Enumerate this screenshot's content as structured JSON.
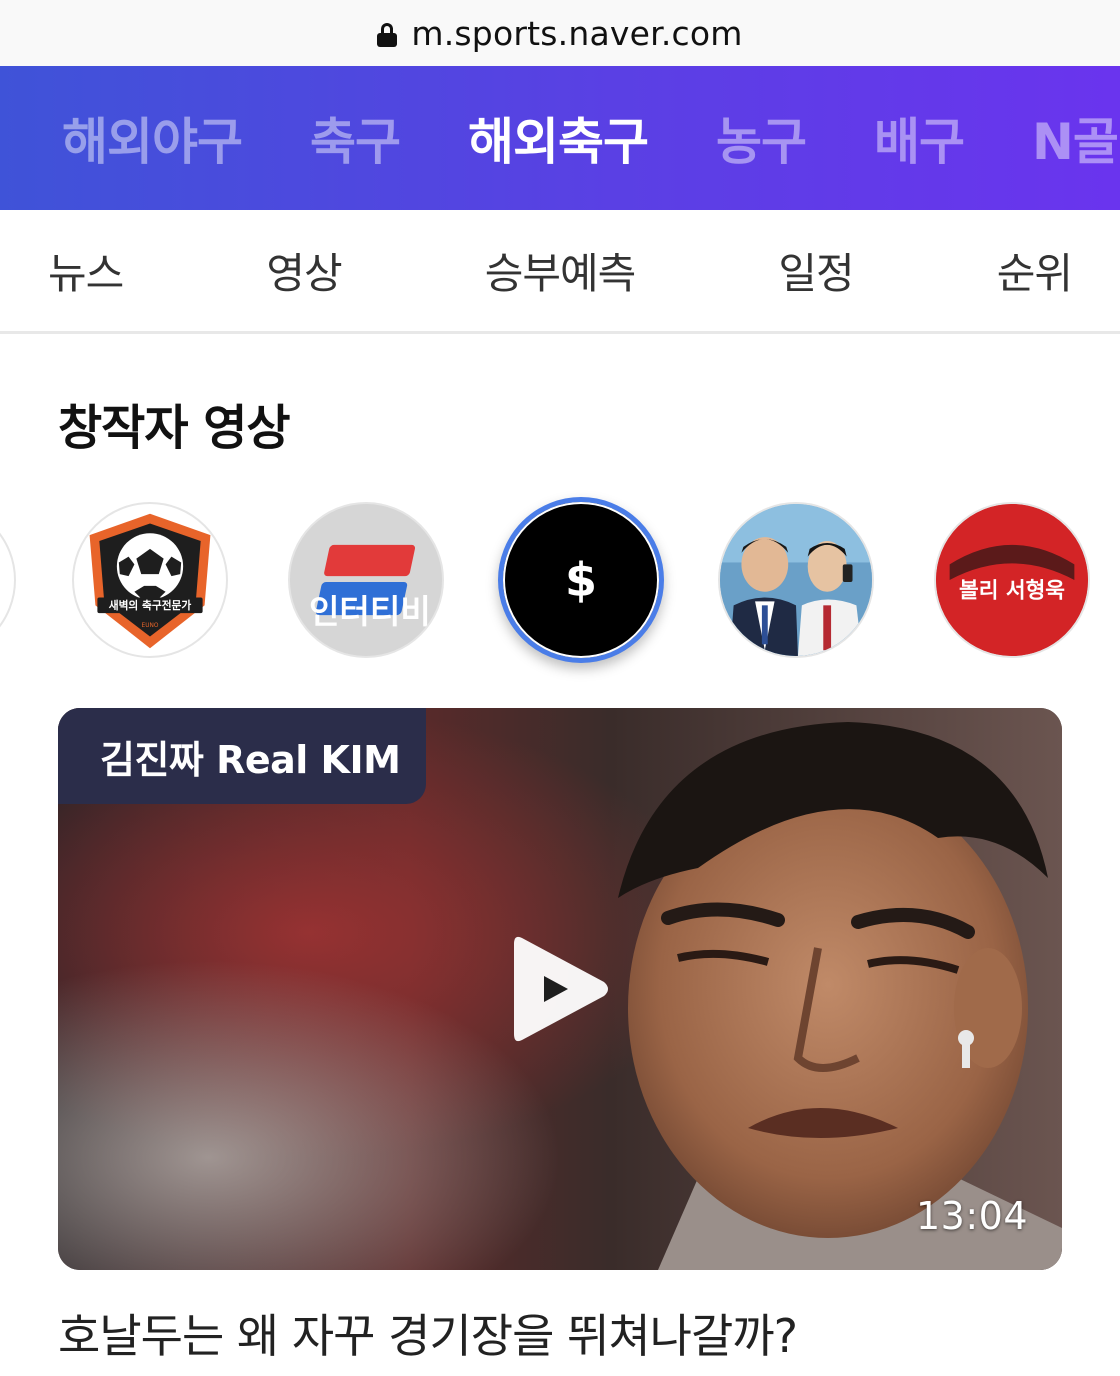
{
  "browser": {
    "url": "m.sports.naver.com"
  },
  "sport_tabs": [
    {
      "label": "해외야구"
    },
    {
      "label": "축구"
    },
    {
      "label": "해외축구",
      "active": true
    },
    {
      "label": "농구"
    },
    {
      "label": "배구"
    },
    {
      "label": "N골"
    }
  ],
  "sub_tabs": [
    {
      "label": "뉴스"
    },
    {
      "label": "영상"
    },
    {
      "label": "승부예측"
    },
    {
      "label": "일정"
    },
    {
      "label": "순위"
    }
  ],
  "section": {
    "title": "창작자 영상"
  },
  "creators": [
    {
      "logo_text": "새벽의 축구전문가",
      "logo_subtext": "EUNO"
    },
    {
      "logo_text": "인터티비"
    },
    {
      "logo_text": "$",
      "selected": true
    },
    {
      "logo_text": ""
    },
    {
      "logo_text": "볼리 서형욱"
    }
  ],
  "video": {
    "creator": "김진짜 Real KIM",
    "duration": "13:04",
    "title": "호날두는 왜 자꾸 경기장을 뛰쳐나갈까?"
  },
  "colors": {
    "tab_gradient_start": "#3f53d8",
    "tab_gradient_end": "#6a34ee",
    "selected_ring": "#4a7de8",
    "badge_bg": "#2b2d4a"
  }
}
